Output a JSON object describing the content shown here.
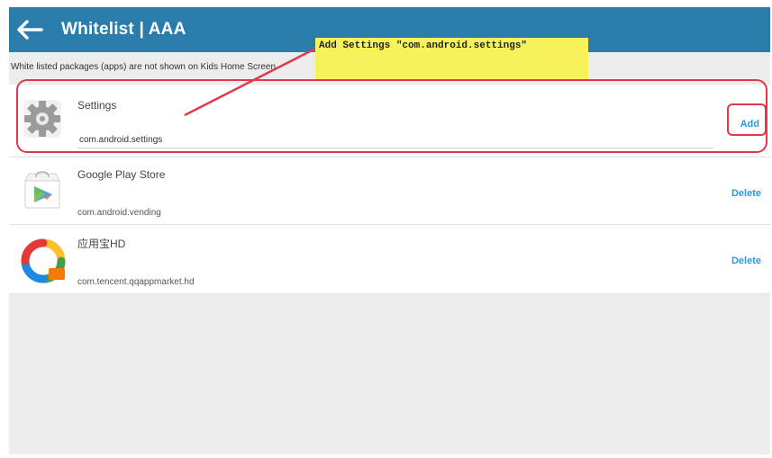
{
  "appbar": {
    "title": "Whitelist | AAA",
    "color": "#2a7dab",
    "back_icon": "arrow-left-icon"
  },
  "subhead": "White listed packages (apps) are not shown on Kids Home Screen",
  "apps": [
    {
      "name": "Settings",
      "package": "com.android.settings",
      "action": "Add",
      "icon": "gear-icon"
    },
    {
      "name": "Google Play Store",
      "package": "com.android.vending",
      "action": "Delete",
      "icon": "play-store-icon"
    },
    {
      "name": "应用宝HD",
      "package": "com.tencent.qqappmarket.hd",
      "action": "Delete",
      "icon": "yingyongbao-icon"
    }
  ],
  "annotation": {
    "text": "Add Settings \"com.android.settings\"",
    "highlight_color": "#e0394a",
    "callout_color": "#f7f25a"
  }
}
